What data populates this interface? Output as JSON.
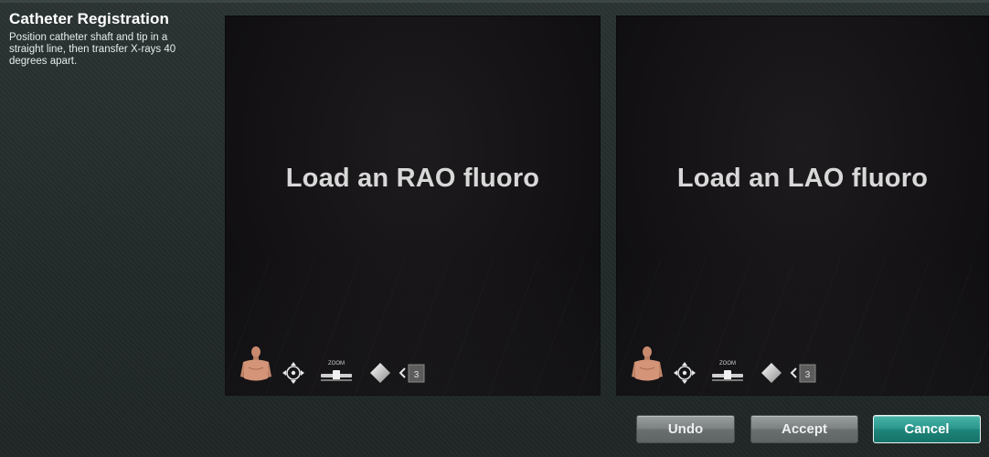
{
  "sidebar": {
    "title": "Catheter Registration",
    "instructions": "Position catheter shaft and tip in a straight line, then transfer X-rays 40 degrees apart."
  },
  "viewports": [
    {
      "message": "Load an RAO fluoro",
      "zoom_label": "ZOOM"
    },
    {
      "message": "Load an LAO fluoro",
      "zoom_label": "ZOOM"
    }
  ],
  "toolbar_icons": [
    "torso-icon",
    "pan-icon",
    "zoom-icon",
    "contrast-icon",
    "page-icon"
  ],
  "buttons": {
    "undo": "Undo",
    "accept": "Accept",
    "cancel": "Cancel"
  },
  "colors": {
    "primary_button": "#2a978c",
    "secondary_button": "#7c8182",
    "viewport_bg": "#141214",
    "panel_bg": "#252d2c"
  }
}
